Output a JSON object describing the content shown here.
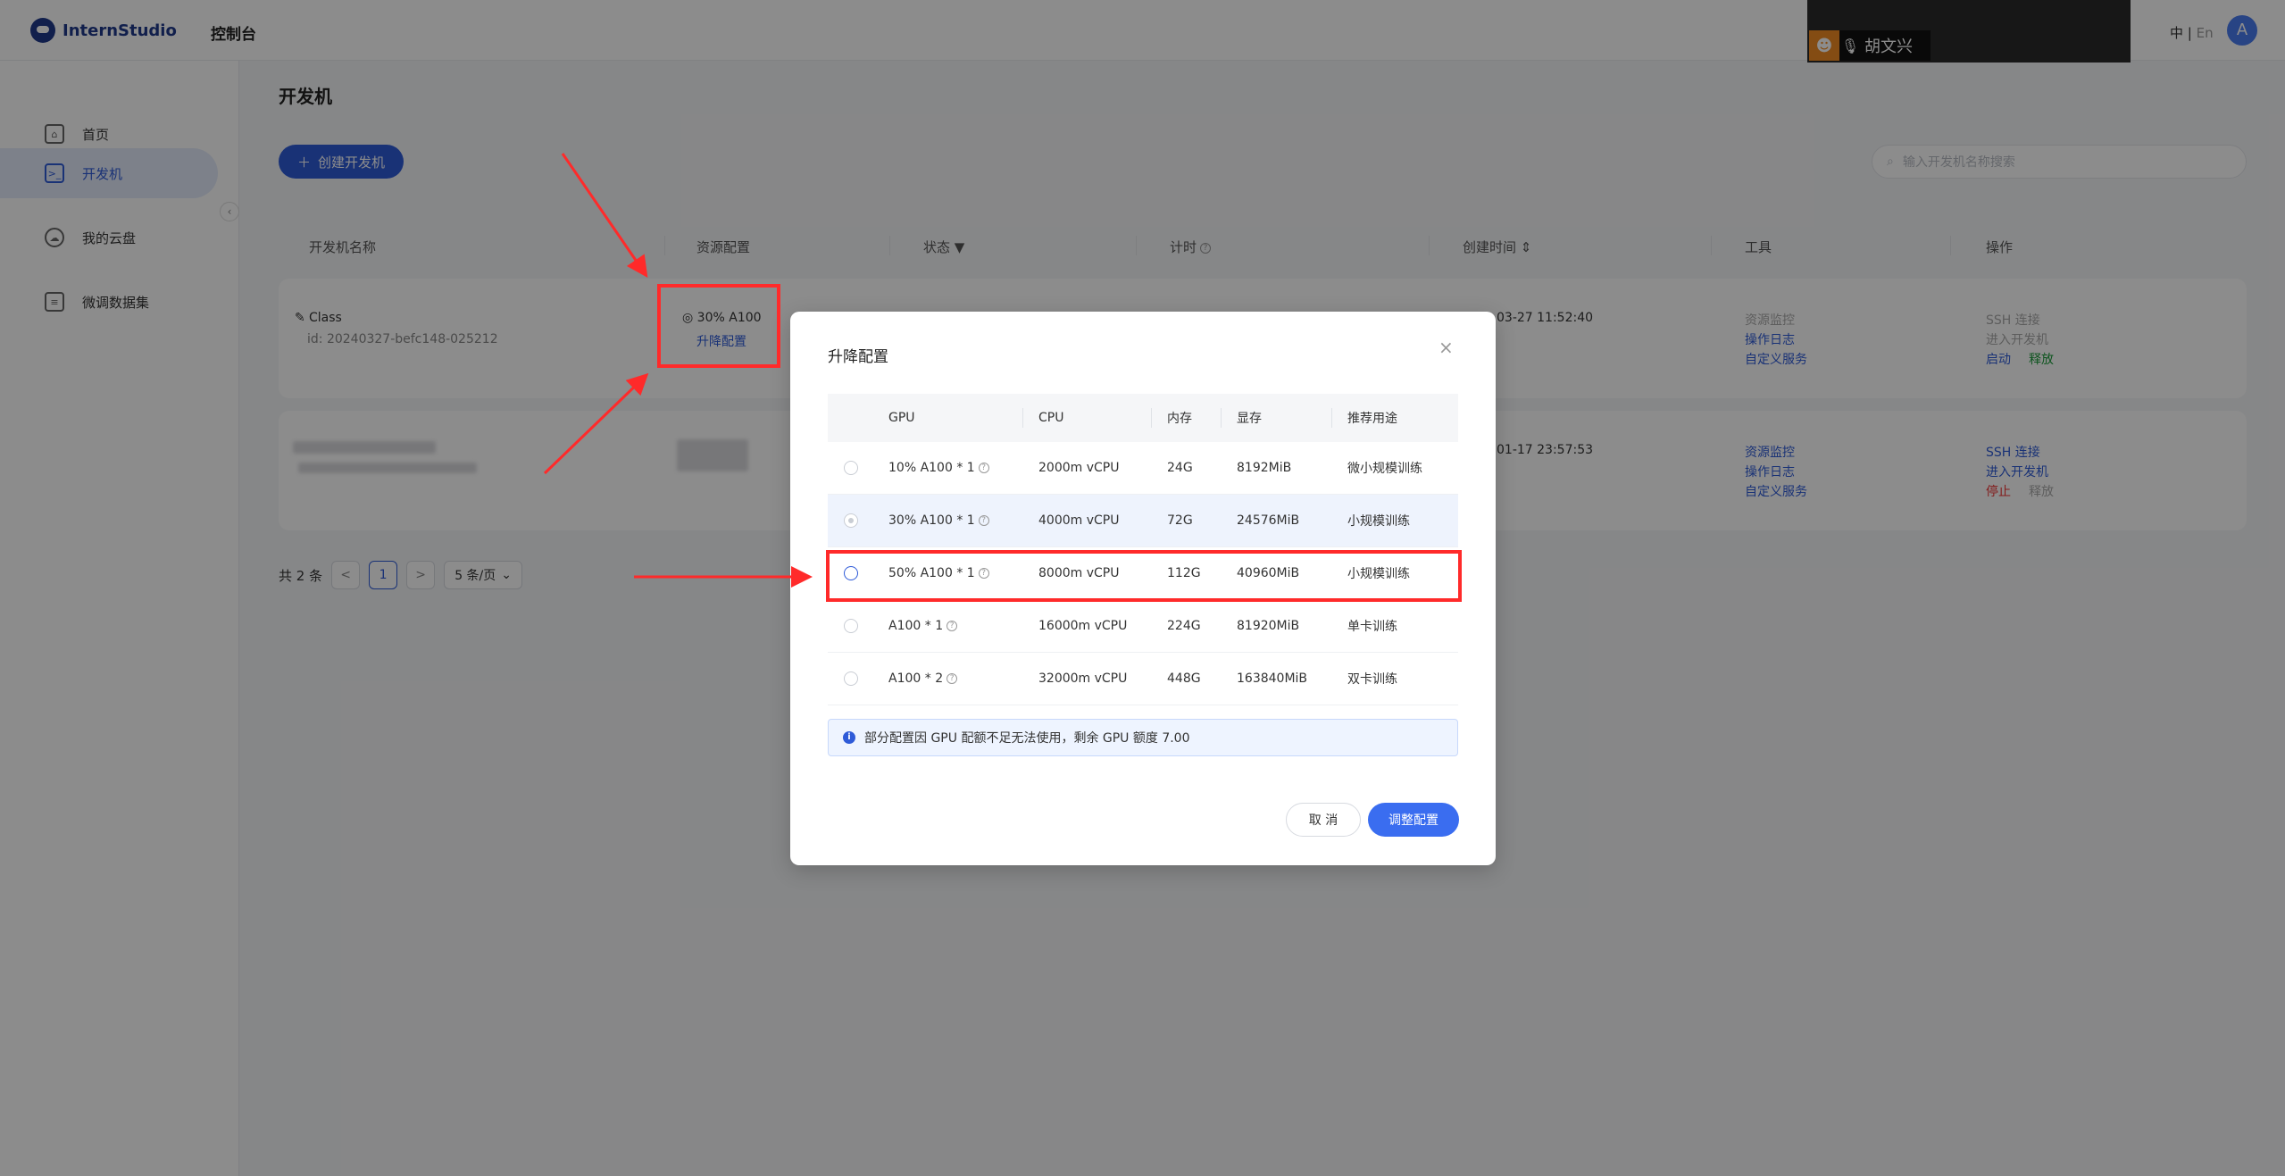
{
  "header": {
    "logo_text": "InternStudio",
    "console_label": "控制台",
    "lang_zh": "中",
    "lang_sep": "|",
    "lang_en": "En",
    "avatar_letter": "A"
  },
  "video_overlay": {
    "name": "胡文兴"
  },
  "sidebar": {
    "items": [
      {
        "label": "首页",
        "active": false
      },
      {
        "label": "开发机",
        "active": true
      },
      {
        "label": "我的云盘",
        "active": false
      },
      {
        "label": "微调数据集",
        "active": false
      }
    ],
    "collapse_glyph": "‹"
  },
  "main": {
    "title": "开发机",
    "create_label": "创建开发机",
    "search_placeholder": "输入开发机名称搜索",
    "columns": [
      "开发机名称",
      "资源配置",
      "状态",
      "计时",
      "创建时间",
      "工具",
      "操作"
    ],
    "rows": [
      {
        "name": "Class",
        "id": "id: 20240327-befc148-025212",
        "resource": "30% A100",
        "resize_link": "升降配置",
        "created": "03-27 11:52:40",
        "tools": [
          "资源监控",
          "操作日志",
          "自定义服务"
        ],
        "actions": [
          "SSH 连接",
          "进入开发机"
        ],
        "action_start": "启动",
        "action_release": "释放"
      },
      {
        "name": "",
        "id": "",
        "resource": "",
        "created": "01-17 23:57:53",
        "tools": [
          "资源监控",
          "操作日志",
          "自定义服务"
        ],
        "actions": [
          "SSH 连接",
          "进入开发机"
        ],
        "action_stop": "停止",
        "action_release": "释放"
      }
    ],
    "pagination": {
      "total": "共 2 条",
      "prev": "<",
      "page": "1",
      "next": ">",
      "page_size": "5 条/页"
    }
  },
  "modal": {
    "title": "升降配置",
    "close": "×",
    "columns": [
      "GPU",
      "CPU",
      "内存",
      "显存",
      "推荐用途"
    ],
    "options": [
      {
        "gpu": "10% A100 * 1",
        "cpu": "2000m vCPU",
        "mem": "24G",
        "vram": "8192MiB",
        "use": "微小规模训练",
        "state": "disabled"
      },
      {
        "gpu": "30% A100 * 1",
        "cpu": "4000m vCPU",
        "mem": "72G",
        "vram": "24576MiB",
        "use": "小规模训练",
        "state": "current"
      },
      {
        "gpu": "50% A100 * 1",
        "cpu": "8000m vCPU",
        "mem": "112G",
        "vram": "40960MiB",
        "use": "小规模训练",
        "state": "available"
      },
      {
        "gpu": "A100 * 1",
        "cpu": "16000m vCPU",
        "mem": "224G",
        "vram": "81920MiB",
        "use": "单卡训练",
        "state": "disabled"
      },
      {
        "gpu": "A100 * 2",
        "cpu": "32000m vCPU",
        "mem": "448G",
        "vram": "163840MiB",
        "use": "双卡训练",
        "state": "disabled"
      }
    ],
    "notice": "部分配置因 GPU 配额不足无法使用，剩余 GPU 额度 7.00",
    "cancel_label": "取 消",
    "confirm_label": "调整配置"
  },
  "colors": {
    "primary": "#2f5bd8",
    "annotation_red": "#ff2a2a",
    "mask": "rgba(0,0,0,0.45)"
  }
}
